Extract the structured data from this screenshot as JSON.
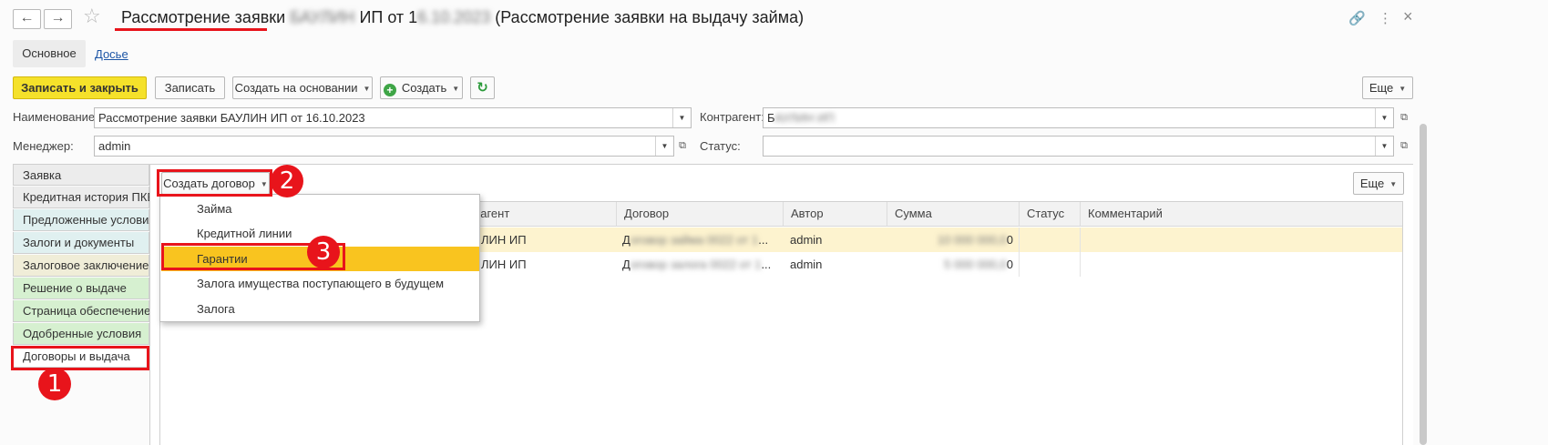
{
  "window": {
    "back_icon": "←",
    "forward_icon": "→",
    "star_icon": "☆",
    "title_main": "Рассмотрение заявки",
    "title_blur1": "БАУЛИН",
    "title_mid": "ИП от 1",
    "title_blur2": "6.10.2023",
    "title_end": "(Рассмотрение заявки на выдачу займа)",
    "link_icon": "🔗",
    "more_icon": "⋮",
    "close_icon": "×"
  },
  "tabs": {
    "main": "Основное",
    "dossier": "Досье"
  },
  "toolbar": {
    "save_close": "Записать и закрыть",
    "save": "Записать",
    "create_based": "Создать на основании",
    "create": "Создать",
    "refresh_icon": "↻",
    "more": "Еще"
  },
  "form": {
    "name_label": "Наименование:",
    "name_value": "Рассмотрение заявки БАУЛИН ИП от 16.10.2023",
    "counterparty_label": "Контрагент:",
    "counterparty_value": "Б",
    "counterparty_blur": "АУЛИН ИП",
    "manager_label": "Менеджер:",
    "manager_value": "admin",
    "status_label": "Статус:",
    "status_value": ""
  },
  "left_tabs": [
    {
      "label": "Заявка",
      "bg": "#ececec"
    },
    {
      "label": "Кредитная история ПКБ",
      "bg": "#ececec"
    },
    {
      "label": "Предложенные условия",
      "bg": "#e0f0f0"
    },
    {
      "label": "Залоги и документы",
      "bg": "#e0f0f0"
    },
    {
      "label": "Залоговое заключение",
      "bg": "#f0edd8"
    },
    {
      "label": "Решение о выдаче",
      "bg": "#d6f0d0"
    },
    {
      "label": "Страница обеспечение",
      "bg": "#d6f0d0"
    },
    {
      "label": "Одобренные условия",
      "bg": "#d6f0d0"
    },
    {
      "label": "Договоры и выдача",
      "bg": "#ffffff"
    }
  ],
  "panel": {
    "create_contract": "Создать договор",
    "more": "Еще"
  },
  "grid": {
    "columns": [
      "Контрагент",
      "Договор",
      "Автор",
      "Сумма",
      "Статус",
      "Комментарий"
    ],
    "header_visible_part": "рагент",
    "rows": [
      {
        "counterparty": "ЛИН ИП",
        "contract": "Д",
        "contract_blur": "оговор займа 0022 от 1",
        "contract_end": "...",
        "author": "admin",
        "sum_blur": "10 000 000,0",
        "sum_end": "0",
        "selected": true
      },
      {
        "counterparty": "ЛИН ИП",
        "contract": "Д",
        "contract_blur": "оговор залога 0022 от 1",
        "contract_end": "...",
        "author": "admin",
        "sum_blur": "5 000 000,0",
        "sum_end": "0",
        "selected": false
      }
    ]
  },
  "dropdown": {
    "items": [
      "Займа",
      "Кредитной линии",
      "Гарантии",
      "Залога имущества поступающего в будущем",
      "Залога"
    ],
    "highlighted_index": 2
  },
  "annotations": {
    "badge1": "1",
    "badge2": "2",
    "badge3": "3"
  },
  "colors": {
    "accent_red": "#e8141b",
    "button_yellow": "#f5e12a",
    "row_selected": "#fdf3cf",
    "menu_highlight": "#f9c41f"
  }
}
